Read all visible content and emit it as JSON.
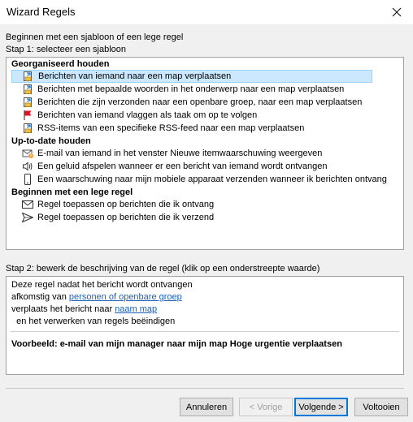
{
  "window": {
    "title": "Wizard Regels"
  },
  "intro": "Beginnen met een sjabloon of een lege regel",
  "step1_label": "Stap 1: selecteer een sjabloon",
  "groups": [
    {
      "title": "Georganiseerd houden",
      "items": [
        {
          "label": "Berichten van iemand naar een map verplaatsen",
          "icon": "folder-move-icon",
          "selected": true
        },
        {
          "label": "Berichten met bepaalde woorden in het onderwerp naar een map verplaatsen",
          "icon": "folder-move-icon"
        },
        {
          "label": "Berichten die zijn verzonden naar een openbare groep, naar een map verplaatsen",
          "icon": "folder-move-icon"
        },
        {
          "label": "Berichten van iemand vlaggen als taak om op te volgen",
          "icon": "flag-icon"
        },
        {
          "label": "RSS-items van een specifieke RSS-feed naar een map verplaatsen",
          "icon": "folder-move-icon"
        }
      ]
    },
    {
      "title": "Up-to-date houden",
      "items": [
        {
          "label": "E-mail van iemand in het venster Nieuwe itemwaarschuwing weergeven",
          "icon": "alert-mail-icon"
        },
        {
          "label": "Een geluid afspelen wanneer er een bericht van iemand wordt ontvangen",
          "icon": "speaker-icon"
        },
        {
          "label": "Een waarschuwing naar mijn mobiele apparaat verzenden wanneer ik berichten ontvang",
          "icon": "mobile-phone-icon"
        }
      ]
    },
    {
      "title": "Beginnen met een lege regel",
      "items": [
        {
          "label": "Regel toepassen op berichten die ik ontvang",
          "icon": "envelope-icon"
        },
        {
          "label": "Regel toepassen op berichten die ik verzend",
          "icon": "send-icon"
        }
      ]
    }
  ],
  "step2_label": "Stap 2: bewerk de beschrijving van de regel (klik op een onderstreepte waarde)",
  "description": {
    "line1": "Deze regel nadat het bericht wordt ontvangen",
    "line2_prefix": "afkomstig van ",
    "line2_link": "personen of openbare groep",
    "line3_prefix": "verplaats het bericht naar ",
    "line3_link": "naam map",
    "line4": "  en het verwerken van regels beëindigen",
    "example": "Voorbeeld: e-mail van mijn manager naar mijn map Hoge urgentie verplaatsen"
  },
  "buttons": {
    "cancel": "Annuleren",
    "back": "< Vorige",
    "next": "Volgende >",
    "finish": "Voltooien"
  },
  "colors": {
    "selection_bg": "#cce8ff",
    "selection_border": "#99d1ff",
    "link": "#1c5fb8",
    "default_button_border": "#0078d7",
    "flag": "#e81123",
    "folder": "#f3c03e",
    "arrow": "#2b7cd3"
  }
}
